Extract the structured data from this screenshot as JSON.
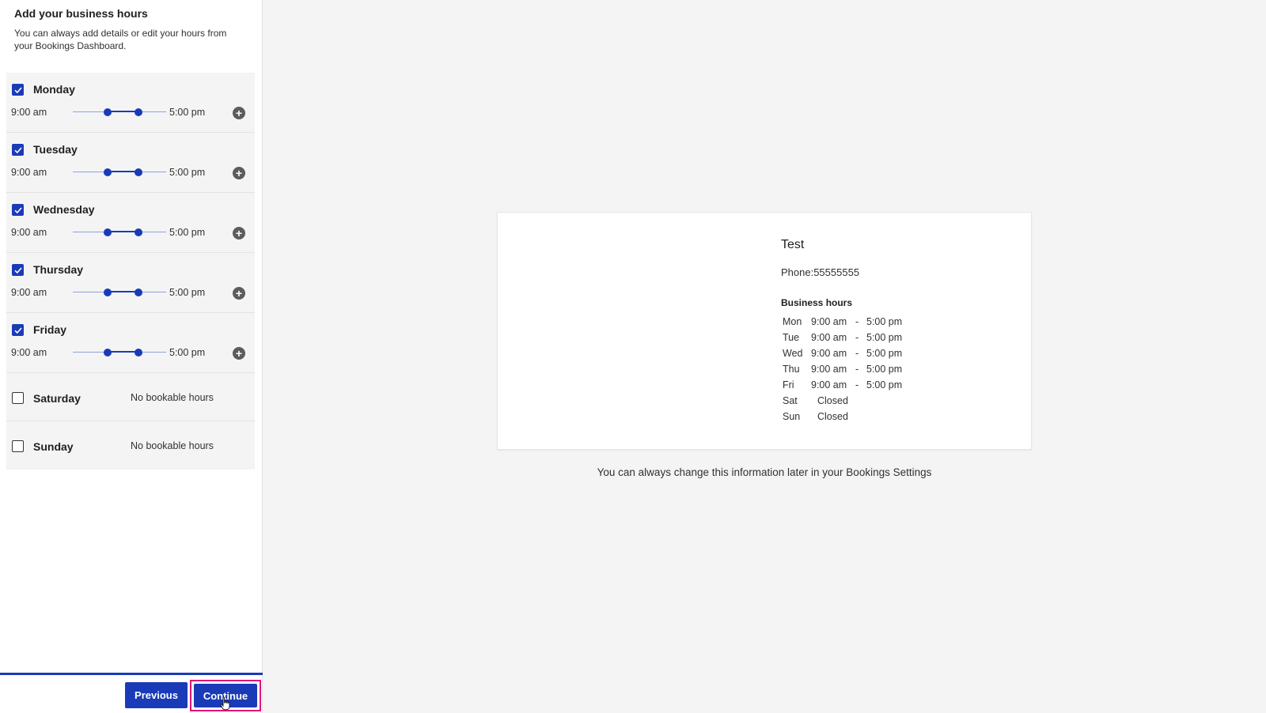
{
  "panel": {
    "title": "Add your business hours",
    "subtitle": "You can always add details or edit your hours from your Bookings Dashboard."
  },
  "days": [
    {
      "name": "Monday",
      "checked": true,
      "start": "9:00 am",
      "end": "5:00 pm",
      "range_fraction": [
        0.37,
        0.7
      ]
    },
    {
      "name": "Tuesday",
      "checked": true,
      "start": "9:00 am",
      "end": "5:00 pm",
      "range_fraction": [
        0.37,
        0.7
      ]
    },
    {
      "name": "Wednesday",
      "checked": true,
      "start": "9:00 am",
      "end": "5:00 pm",
      "range_fraction": [
        0.37,
        0.7
      ]
    },
    {
      "name": "Thursday",
      "checked": true,
      "start": "9:00 am",
      "end": "5:00 pm",
      "range_fraction": [
        0.37,
        0.7
      ]
    },
    {
      "name": "Friday",
      "checked": true,
      "start": "9:00 am",
      "end": "5:00 pm",
      "range_fraction": [
        0.37,
        0.7
      ]
    },
    {
      "name": "Saturday",
      "checked": false,
      "status": "No bookable hours"
    },
    {
      "name": "Sunday",
      "checked": false,
      "status": "No bookable hours"
    }
  ],
  "footer": {
    "previous_label": "Previous",
    "continue_label": "Continue"
  },
  "preview": {
    "business_name": "Test",
    "phone": "Phone:55555555",
    "hours_heading": "Business hours",
    "hours": [
      {
        "day": "Mon",
        "open": "9:00 am",
        "dash": "-",
        "close": "5:00 pm"
      },
      {
        "day": "Tue",
        "open": "9:00 am",
        "dash": "-",
        "close": "5:00 pm"
      },
      {
        "day": "Wed",
        "open": "9:00 am",
        "dash": "-",
        "close": "5:00 pm"
      },
      {
        "day": "Thu",
        "open": "9:00 am",
        "dash": "-",
        "close": "5:00 pm"
      },
      {
        "day": "Fri",
        "open": "9:00 am",
        "dash": "-",
        "close": "5:00 pm"
      },
      {
        "day": "Sat",
        "closed": "Closed"
      },
      {
        "day": "Sun",
        "closed": "Closed"
      }
    ],
    "note": "You can always change this information later in your Bookings Settings"
  },
  "colors": {
    "accent": "#1a3bb8",
    "highlight": "#e0157a"
  },
  "icons": {
    "checkbox_checked": "check-icon",
    "add_hours": "plus-circle-icon",
    "cursor": "hand-pointer-icon"
  }
}
